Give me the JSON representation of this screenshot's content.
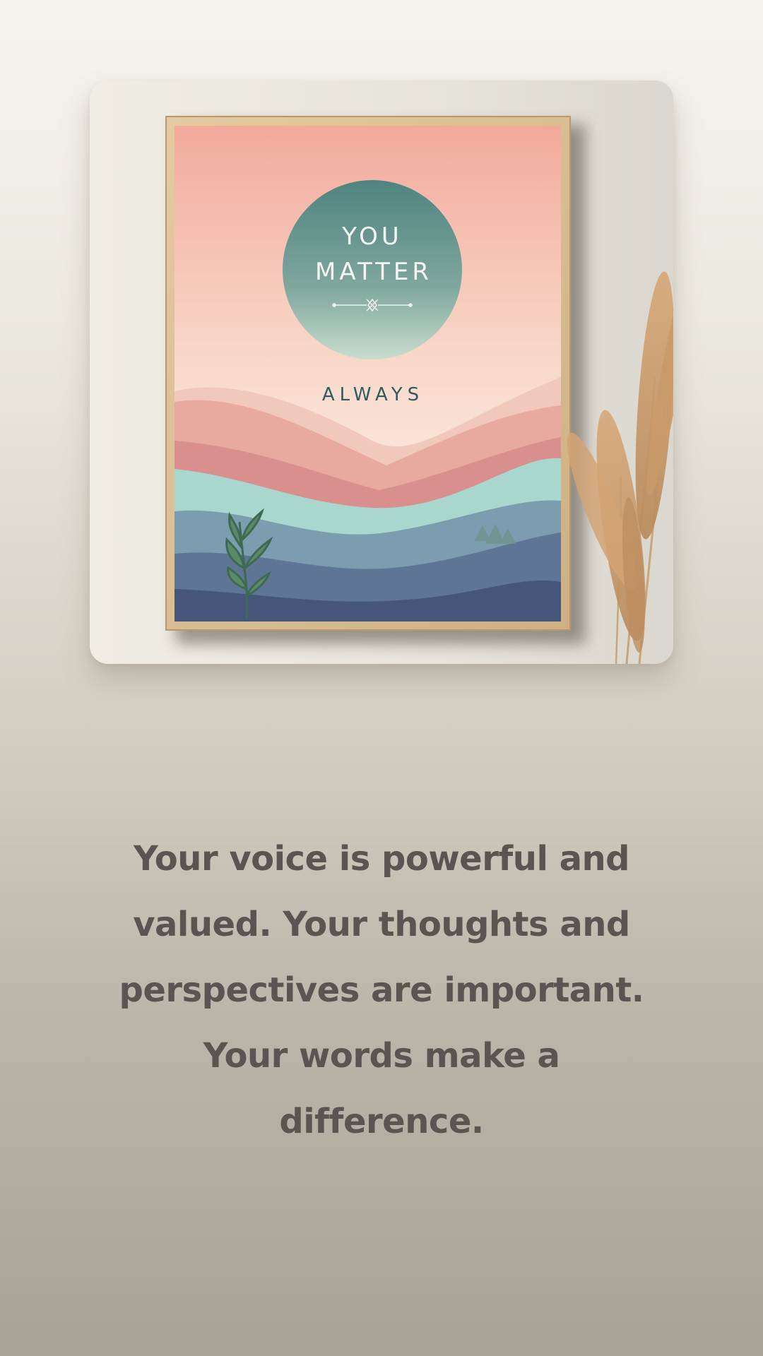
{
  "poster": {
    "line1": "YOU",
    "line2": "MATTER",
    "subtitle": "ALWAYS"
  },
  "message": {
    "text": "Your voice is powerful and valued. Your thoughts and perspectives are important. Your words make a difference."
  },
  "colors": {
    "background_top": "#f6f4ee",
    "background_bottom": "#a9a397",
    "text": "#5c5450",
    "poster_pink": "#f2b0a0",
    "poster_teal_circle": "#5f8e88",
    "frame_wood": "#d9bd93"
  },
  "icons": {
    "pampas_grass": "pampas-grass-icon",
    "plant": "plant-sprig-icon",
    "trees": "tree-cluster-icon",
    "ornament": "divider-ornament-icon"
  }
}
